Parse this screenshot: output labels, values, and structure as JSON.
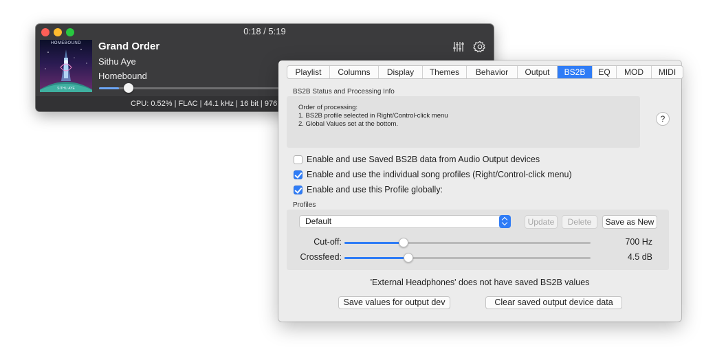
{
  "player": {
    "time": "0:18 / 5:19",
    "track_title": "Grand Order",
    "artist": "Sithu Aye",
    "album": "Homebound",
    "album_art_title": "HOMEBOUND",
    "album_art_artist": "SITHU AYE",
    "progress_fraction": 0.056,
    "status": "CPU: 0.52% | FLAC | 44.1 kHz | 16 bit | 976"
  },
  "prefs": {
    "tabs": [
      {
        "label": "Playlist",
        "active": false
      },
      {
        "label": "Columns",
        "active": false
      },
      {
        "label": "Display",
        "active": false
      },
      {
        "label": "Themes",
        "active": false
      },
      {
        "label": "Behavior",
        "active": false
      },
      {
        "label": "Output",
        "active": false
      },
      {
        "label": "BS2B",
        "active": true
      },
      {
        "label": "EQ",
        "active": false
      },
      {
        "label": "MOD",
        "active": false
      },
      {
        "label": "MIDI",
        "active": false
      }
    ],
    "status_heading": "BS2B Status and Processing Info",
    "info_lines": [
      "Order of processing:",
      "1. BS2B profile selected in Right/Control-click menu",
      "2. Global Values set at the bottom."
    ],
    "help_label": "?",
    "checkboxes": [
      {
        "label": "Enable and use Saved BS2B data from Audio Output devices",
        "checked": false
      },
      {
        "label": "Enable and use the individual song profiles (Right/Control-click menu)",
        "checked": true
      },
      {
        "label": "Enable and use this Profile globally:",
        "checked": true
      }
    ],
    "profiles_heading": "Profiles",
    "profile_selected": "Default",
    "update_label": "Update",
    "delete_label": "Delete",
    "save_as_new_label": "Save as New",
    "cutoff": {
      "label": "Cut-off:",
      "value_text": "700 Hz",
      "fraction": 0.24
    },
    "crossfeed": {
      "label": "Crossfeed:",
      "value_text": "4.5 dB",
      "fraction": 0.26
    },
    "device_message": "'External Headphones' does not have saved BS2B values",
    "save_device_label": "Save values for output dev",
    "clear_device_label": "Clear saved output device data"
  },
  "colors": {
    "accent": "#2f7cf6",
    "player_bg": "#3b3b3d",
    "panel_bg": "#ececec"
  },
  "icons": [
    "equalizer-sliders-icon",
    "gear-icon",
    "help-icon",
    "select-stepper-icon"
  ]
}
